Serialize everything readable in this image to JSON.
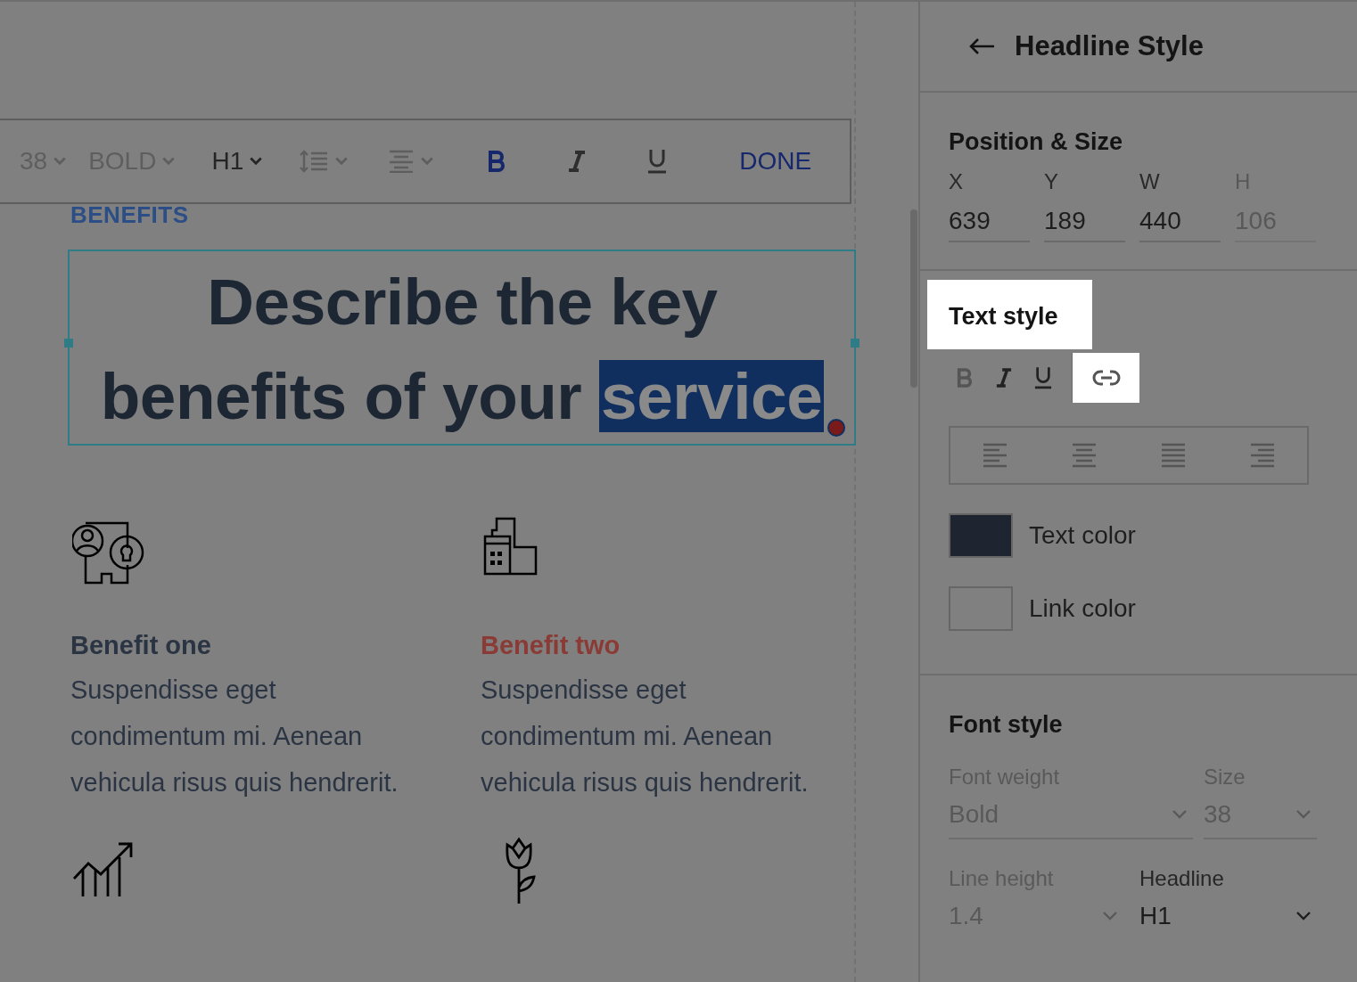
{
  "toolbar": {
    "items": [
      {
        "kind": "dropdown",
        "label": "38",
        "disabled": true
      },
      {
        "kind": "dropdown",
        "label": "BOLD",
        "disabled": true
      },
      {
        "kind": "dropdown",
        "label": "H1",
        "disabled": false
      },
      {
        "kind": "spacing",
        "disabled": true
      },
      {
        "kind": "align",
        "disabled": true
      },
      {
        "kind": "bold",
        "selected": true
      },
      {
        "kind": "italic",
        "selected": false
      },
      {
        "kind": "underline",
        "selected": false
      },
      {
        "kind": "done",
        "label": "DONE"
      }
    ]
  },
  "eyebrow": "BENEFITS",
  "headline": {
    "lines": [
      "Describe the key",
      "benefits of your"
    ],
    "selection": "service"
  },
  "benefits": [
    {
      "kind": "people-lock",
      "title": "Benefit one",
      "color": "#2b3442",
      "lines": [
        "Suspendisse eget",
        "condimentum mi. Aenean",
        "vehicula risus quis hendrerit."
      ]
    },
    {
      "kind": "buildings",
      "title": "Benefit two",
      "color": "#8a3b35",
      "lines": [
        "Suspendisse eget",
        "condimentum mi. Aenean",
        "vehicula risus quis hendrerit."
      ]
    },
    {
      "kind": "chart"
    },
    {
      "kind": "tulip"
    }
  ],
  "panel": {
    "title": "Headline Style",
    "position": {
      "title": "Position & Size",
      "fields": [
        {
          "label": "X",
          "value": "639",
          "disabled": false
        },
        {
          "label": "Y",
          "value": "189",
          "disabled": false
        },
        {
          "label": "W",
          "value": "440",
          "disabled": false
        },
        {
          "label": "H",
          "value": "106",
          "disabled": true
        }
      ]
    },
    "text_style": {
      "title": "Text style",
      "highlighted": true,
      "formats": [
        {
          "kind": "bold",
          "highlighted": false
        },
        {
          "kind": "italic",
          "highlighted": false
        },
        {
          "kind": "underline",
          "highlighted": false
        },
        {
          "kind": "link",
          "highlighted": true
        }
      ],
      "aligns": [
        {
          "kind": "left"
        },
        {
          "kind": "center"
        },
        {
          "kind": "justify"
        },
        {
          "kind": "right"
        }
      ],
      "colors": [
        {
          "label": "Text color",
          "color": "#1e2530"
        },
        {
          "label": "Link color",
          "color": "#808080"
        }
      ]
    },
    "font_style": {
      "title": "Font style",
      "fields": [
        {
          "label": "Font weight",
          "value": "Bold",
          "disabled": true
        },
        {
          "label": "Size",
          "value": "38",
          "disabled": true
        },
        {
          "label": "Line height",
          "value": "1.4",
          "disabled": true
        },
        {
          "label": "Headline",
          "value": "H1",
          "disabled": false
        }
      ]
    }
  }
}
